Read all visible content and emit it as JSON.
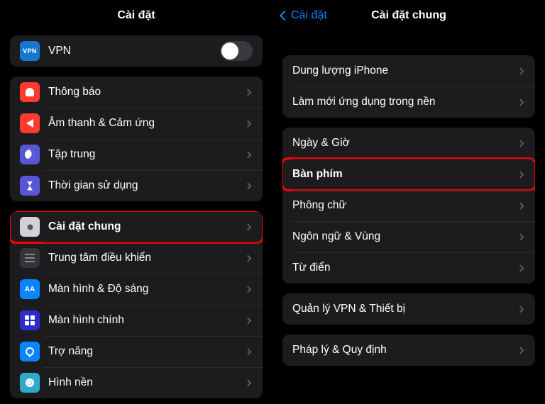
{
  "left": {
    "title": "Cài đặt",
    "vpn": {
      "label": "VPN",
      "badge": "VPN",
      "on": false
    },
    "g1": [
      {
        "key": "notif",
        "label": "Thông báo"
      },
      {
        "key": "sound",
        "label": "Âm thanh & Cảm ứng"
      },
      {
        "key": "focus",
        "label": "Tập trung"
      },
      {
        "key": "screen",
        "label": "Thời gian sử dụng"
      }
    ],
    "g2": [
      {
        "key": "general",
        "label": "Cài đặt chung",
        "highlight": true
      },
      {
        "key": "control",
        "label": "Trung tâm điều khiển"
      },
      {
        "key": "display",
        "label": "Màn hình & Độ sáng",
        "badge": "AA"
      },
      {
        "key": "home",
        "label": "Màn hình chính"
      },
      {
        "key": "access",
        "label": "Trợ năng"
      },
      {
        "key": "wall",
        "label": "Hình nền"
      }
    ]
  },
  "right": {
    "back": "Cài đặt",
    "title": "Cài đặt chung",
    "g1": [
      {
        "label": "Dung lượng iPhone"
      },
      {
        "label": "Làm mới ứng dụng trong nền"
      }
    ],
    "g2": [
      {
        "label": "Ngày & Giờ"
      },
      {
        "label": "Bàn phím",
        "highlight": true
      },
      {
        "label": "Phông chữ"
      },
      {
        "label": "Ngôn ngữ & Vùng"
      },
      {
        "label": "Từ điển"
      }
    ],
    "g3": [
      {
        "label": "Quản lý VPN & Thiết bị"
      }
    ],
    "g4": [
      {
        "label": "Pháp lý & Quy định"
      }
    ]
  }
}
